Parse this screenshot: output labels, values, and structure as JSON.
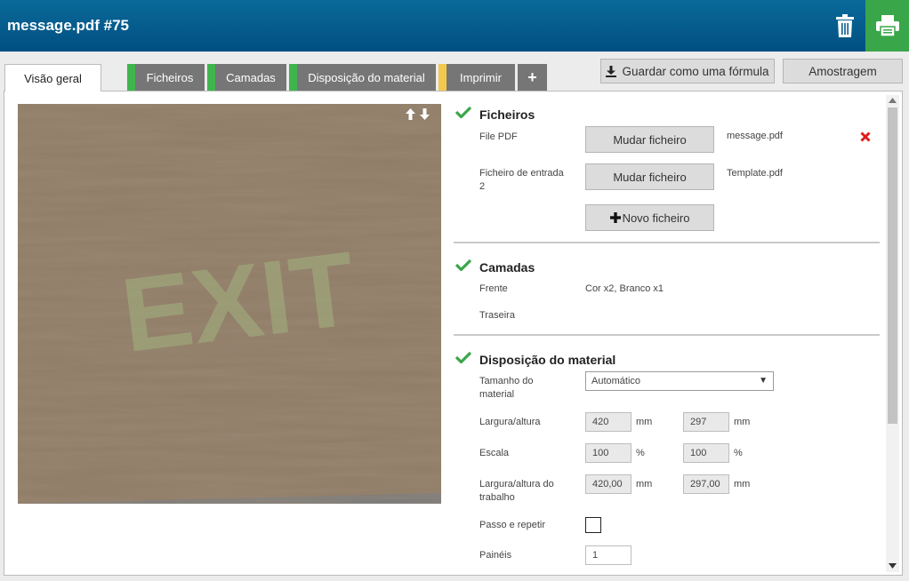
{
  "header": {
    "title": "message.pdf #75",
    "delete_icon": "trash-icon",
    "print_icon": "printer-icon",
    "print_bg": "#3aa64a"
  },
  "tabs": [
    {
      "label": "Visão geral",
      "status": "active"
    },
    {
      "label": "Ficheiros",
      "status_color": "#3fb54e"
    },
    {
      "label": "Camadas",
      "status_color": "#3fb54e"
    },
    {
      "label": "Disposição do material",
      "status_color": "#3fb54e"
    },
    {
      "label": "Imprimir",
      "status_color": "#f2c94c"
    },
    {
      "label": "+",
      "icon": "plus-icon"
    }
  ],
  "actions": {
    "save_formula": "Guardar como uma fórmula",
    "sample": "Amostragem"
  },
  "preview": {
    "watermark_text": "EXIT"
  },
  "files": {
    "title": "Ficheiros",
    "pdf_label": "File PDF",
    "pdf_button": "Mudar ficheiro",
    "pdf_name": "message.pdf",
    "input2_label": "Ficheiro de entrada 2",
    "input2_button": "Mudar ficheiro",
    "input2_name": "Template.pdf",
    "new_file_button": "Novo ficheiro"
  },
  "layers": {
    "title": "Camadas",
    "front_label": "Frente",
    "front_value": "Cor x2, Branco x1",
    "back_label": "Traseira",
    "back_value": ""
  },
  "layout": {
    "title": "Disposição do material",
    "media_size_label": "Tamanho do material",
    "media_size_value": "Automático",
    "wh_label": "Largura/altura",
    "width": "420",
    "height": "297",
    "unit_mm": "mm",
    "scale_label": "Escala",
    "scale_x": "100",
    "scale_y": "100",
    "unit_pct": "%",
    "job_wh_label": "Largura/altura do trabalho",
    "job_width": "420,00",
    "job_height": "297,00",
    "step_repeat_label": "Passo e repetir",
    "step_repeat_checked": false,
    "panels_label": "Painéis",
    "panels_value": "1"
  }
}
